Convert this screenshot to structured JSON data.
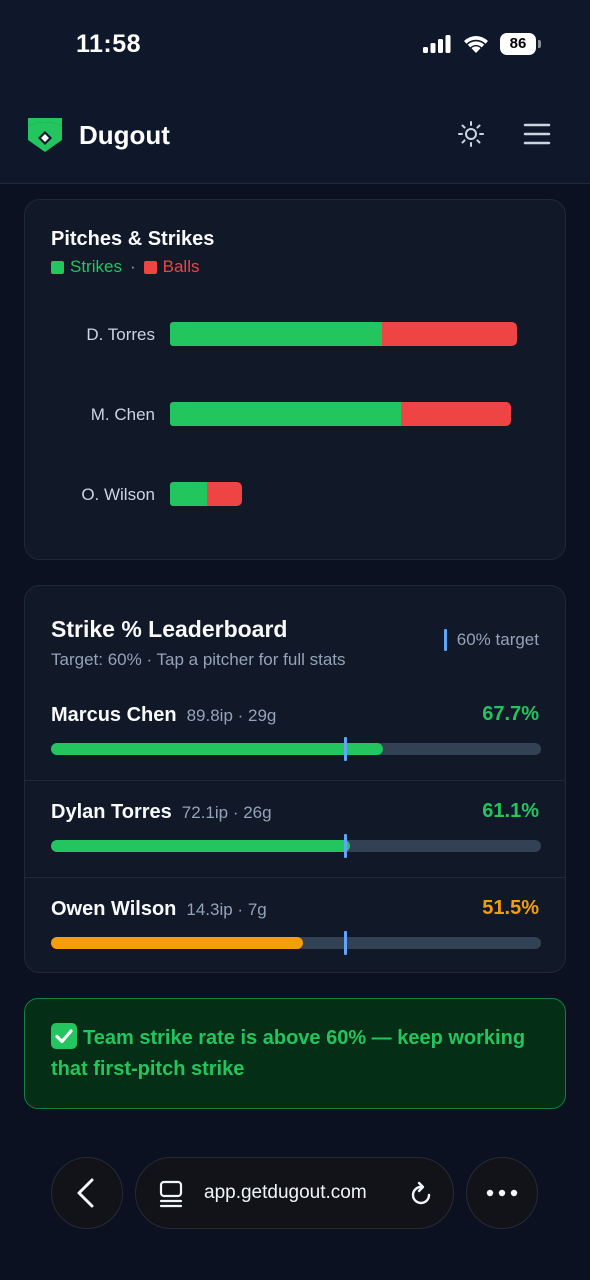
{
  "status_bar": {
    "time": "11:58",
    "battery": "86"
  },
  "header": {
    "app_name": "Dugout",
    "icons": [
      "dugout-logo-icon",
      "sun-icon",
      "menu-icon"
    ]
  },
  "chart_card": {
    "title": "Pitches & Strikes",
    "legend": {
      "strikes": "Strikes",
      "separator": "·",
      "balls": "Balls"
    }
  },
  "chart_data": {
    "type": "bar",
    "stacked": true,
    "orientation": "horizontal",
    "title": "Pitches & Strikes",
    "categories": [
      "D. Torres",
      "M. Chen",
      "O. Wilson"
    ],
    "series": [
      {
        "name": "Strikes",
        "values": [
          212,
          231,
          37
        ],
        "color": "#22c55e"
      },
      {
        "name": "Balls",
        "values": [
          135,
          110,
          35
        ],
        "color": "#ef4444"
      }
    ]
  },
  "leaderboard": {
    "title": "Strike % Leaderboard",
    "subtitle": "Target: 60% · Tap a pitcher for full stats",
    "target_label": "60% target",
    "target_fraction": 0.6,
    "pitchers": [
      {
        "name": "Marcus Chen",
        "meta": "89.8ip · 29g",
        "pct": "67.7%",
        "fraction": 0.677,
        "color": "#22c55e"
      },
      {
        "name": "Dylan Torres",
        "meta": "72.1ip · 26g",
        "pct": "61.1%",
        "fraction": 0.611,
        "color": "#22c55e"
      },
      {
        "name": "Owen Wilson",
        "meta": "14.3ip · 7g",
        "pct": "51.5%",
        "fraction": 0.515,
        "color": "#f59e0b"
      }
    ]
  },
  "banner": {
    "text": "Team strike rate is above 60% — keep working that first-pitch strike",
    "icon": "check-mark-icon"
  },
  "browser": {
    "url": "app.getdugout.com",
    "icons": [
      "back-icon",
      "tabs-icon",
      "reload-icon",
      "more-icon"
    ]
  }
}
